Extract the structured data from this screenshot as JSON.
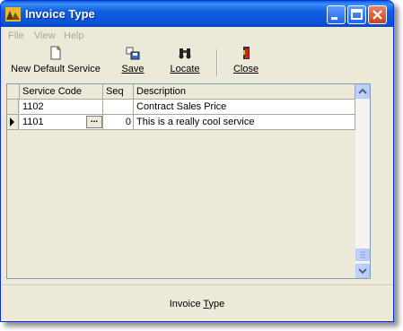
{
  "window": {
    "title": "Invoice Type"
  },
  "menu": {
    "items": [
      "File",
      "View",
      "Help"
    ]
  },
  "toolbar": {
    "new_label": "New Default Service",
    "save_label": "Save",
    "locate_label": "Locate",
    "close_label": "Close"
  },
  "grid": {
    "headers": [
      "Service Code",
      "Seq",
      "Description"
    ],
    "rows": [
      {
        "service_code": "1102",
        "seq": "",
        "description": "Contract Sales Price"
      },
      {
        "service_code": "1101",
        "seq": "0",
        "description": "This is a really cool service"
      }
    ],
    "ellipsis": "..."
  },
  "status": {
    "text": "Invoice Type"
  },
  "colors": {
    "titlebar": "#0b54d6",
    "window_bg": "#ece9d8",
    "grid_border": "#7f9db9"
  }
}
